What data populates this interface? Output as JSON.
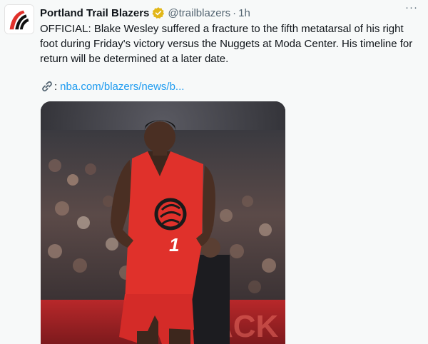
{
  "tweet": {
    "author_name": "Portland Trail Blazers",
    "handle": "@trailblazers",
    "separator": "·",
    "time": "1h",
    "more_label": "···",
    "text": "OFFICIAL: Blake Wesley suffered a fracture to the fifth metatarsal of his right foot during Friday's victory versus the Nuggets at Moda Center. His timeline for return will be determined at a later date.",
    "link_colon": ":",
    "link_text": "nba.com/blazers/news/b...",
    "photo": {
      "jersey_number": "1",
      "court_signage": "ACK"
    }
  },
  "colors": {
    "link": "#1d9bf0",
    "verified": "#e2b719",
    "jersey": "#e0312b",
    "muted": "#536471"
  },
  "icons": {
    "verified": "verified-badge-icon",
    "link": "link-chain-icon",
    "more": "more-options-icon"
  }
}
